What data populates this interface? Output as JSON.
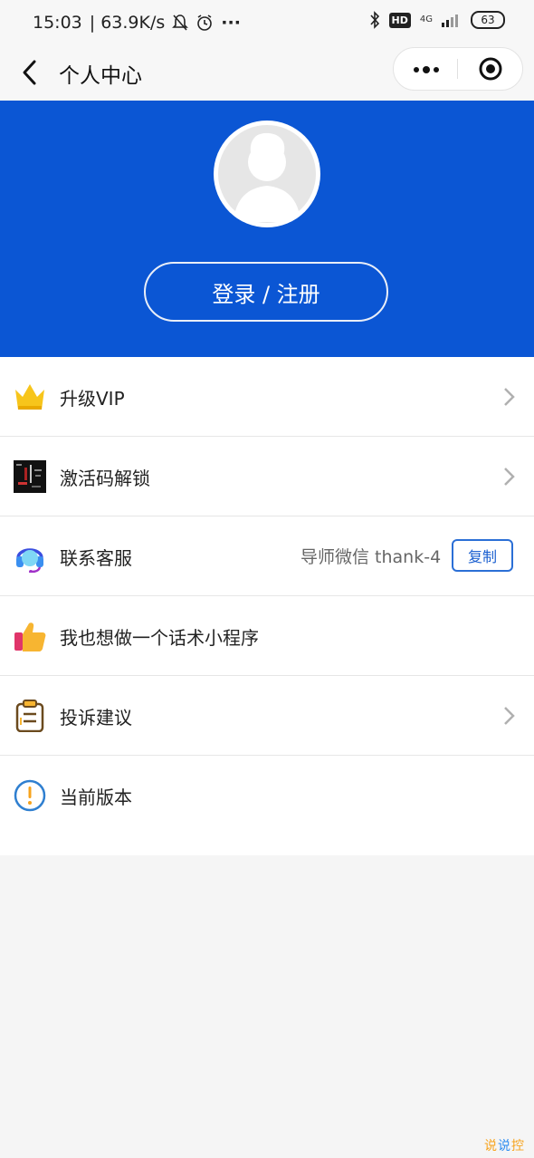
{
  "status_bar": {
    "time": "15:03",
    "net_speed": "| 63.9K/s",
    "more": "···",
    "hd": "HD",
    "net_type": "4G",
    "battery": "63"
  },
  "nav": {
    "title": "个人中心"
  },
  "header": {
    "login_label": "登录 / 注册"
  },
  "menu": [
    {
      "label": "升级VIP",
      "icon": "crown-icon",
      "chevron": true
    },
    {
      "label": "激活码解锁",
      "icon": "activation-thumbnail-icon",
      "chevron": true
    },
    {
      "label": "联系客服",
      "icon": "headset-icon",
      "extra": "导师微信 thank-4",
      "action": "复制"
    },
    {
      "label": "我也想做一个话术小程序",
      "icon": "thumbs-up-icon"
    },
    {
      "label": "投诉建议",
      "icon": "clipboard-icon",
      "chevron": true
    },
    {
      "label": "当前版本",
      "icon": "info-icon"
    }
  ],
  "watermark": {
    "part1": "说",
    "part2": "说",
    "part3": "控"
  },
  "colors": {
    "brand_blue": "#0b56d4",
    "accent_gold": "#f7c51b"
  }
}
